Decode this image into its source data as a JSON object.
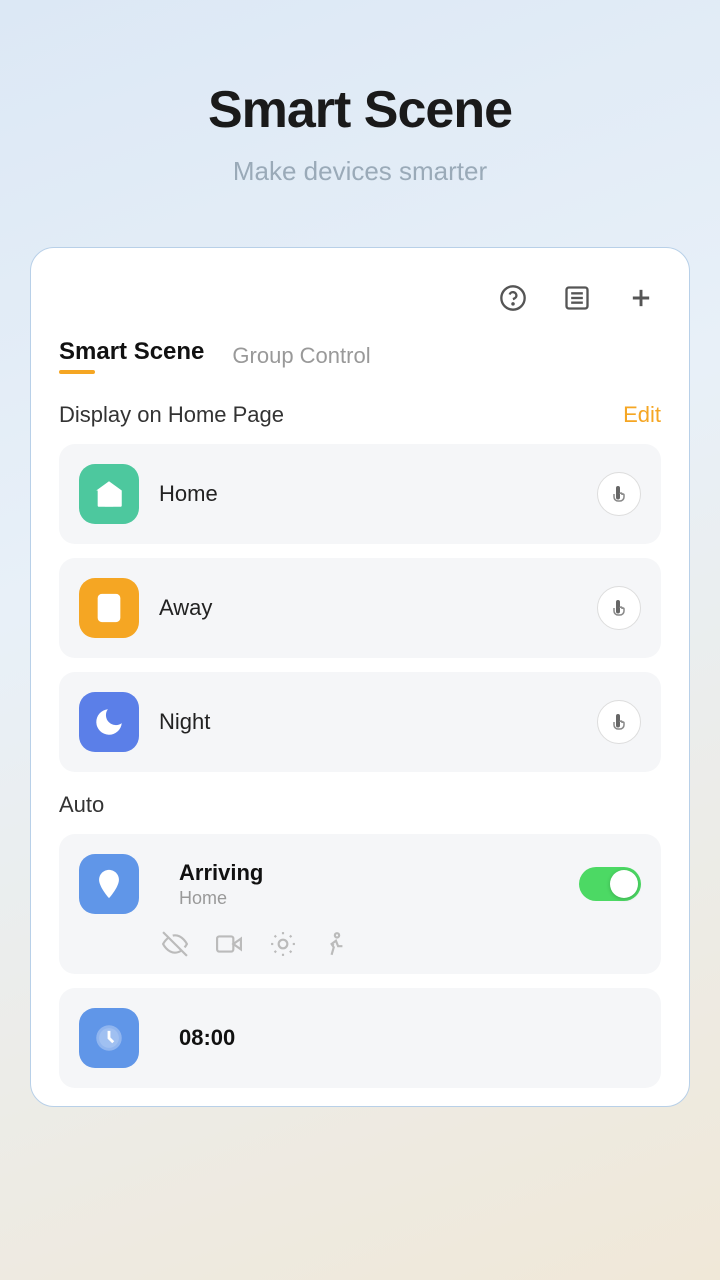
{
  "page": {
    "title": "Smart Scene",
    "subtitle": "Make devices smarter"
  },
  "toolbar": {
    "help_icon": "?",
    "list_icon": "≡",
    "add_icon": "+"
  },
  "tabs": [
    {
      "label": "Smart Scene",
      "active": true
    },
    {
      "label": "Group Control",
      "active": false
    }
  ],
  "display_section": {
    "title": "Display on Home Page",
    "edit_label": "Edit"
  },
  "scenes": [
    {
      "name": "Home",
      "icon_type": "home",
      "color": "green"
    },
    {
      "name": "Away",
      "icon_type": "door",
      "color": "orange"
    },
    {
      "name": "Night",
      "icon_type": "moon",
      "color": "blue"
    }
  ],
  "auto_section": {
    "title": "Auto"
  },
  "auto_items": [
    {
      "name": "Arriving",
      "sub": "Home",
      "icon_type": "location",
      "color": "blue-light",
      "toggle": true,
      "conditions": [
        "eye-off",
        "video",
        "motion",
        "walk"
      ]
    }
  ],
  "partial_item": {
    "time": "08:00",
    "icon_type": "clock",
    "color": "blue-light"
  }
}
